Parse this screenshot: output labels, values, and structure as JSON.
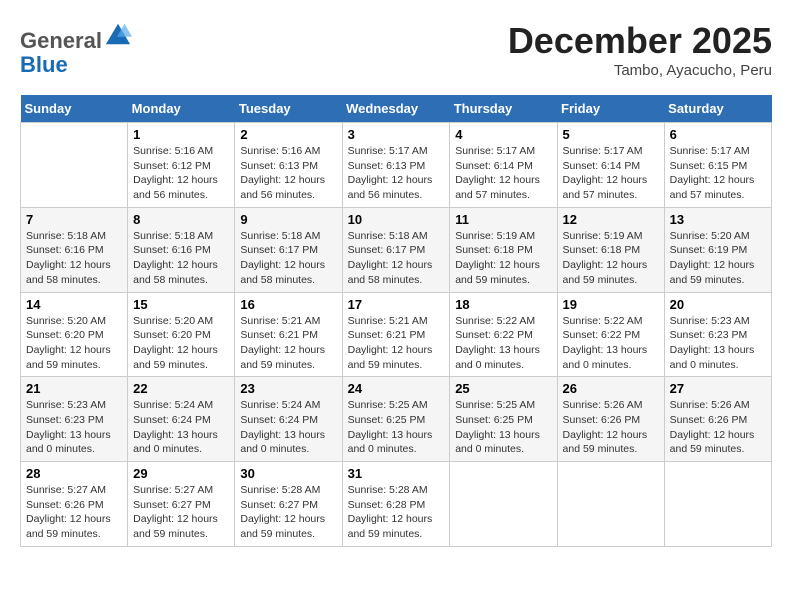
{
  "header": {
    "logo_line1": "General",
    "logo_line2": "Blue",
    "month": "December 2025",
    "location": "Tambo, Ayacucho, Peru"
  },
  "weekdays": [
    "Sunday",
    "Monday",
    "Tuesday",
    "Wednesday",
    "Thursday",
    "Friday",
    "Saturday"
  ],
  "weeks": [
    [
      {
        "day": "",
        "info": ""
      },
      {
        "day": "1",
        "info": "Sunrise: 5:16 AM\nSunset: 6:12 PM\nDaylight: 12 hours\nand 56 minutes."
      },
      {
        "day": "2",
        "info": "Sunrise: 5:16 AM\nSunset: 6:13 PM\nDaylight: 12 hours\nand 56 minutes."
      },
      {
        "day": "3",
        "info": "Sunrise: 5:17 AM\nSunset: 6:13 PM\nDaylight: 12 hours\nand 56 minutes."
      },
      {
        "day": "4",
        "info": "Sunrise: 5:17 AM\nSunset: 6:14 PM\nDaylight: 12 hours\nand 57 minutes."
      },
      {
        "day": "5",
        "info": "Sunrise: 5:17 AM\nSunset: 6:14 PM\nDaylight: 12 hours\nand 57 minutes."
      },
      {
        "day": "6",
        "info": "Sunrise: 5:17 AM\nSunset: 6:15 PM\nDaylight: 12 hours\nand 57 minutes."
      }
    ],
    [
      {
        "day": "7",
        "info": "Sunrise: 5:18 AM\nSunset: 6:16 PM\nDaylight: 12 hours\nand 58 minutes."
      },
      {
        "day": "8",
        "info": "Sunrise: 5:18 AM\nSunset: 6:16 PM\nDaylight: 12 hours\nand 58 minutes."
      },
      {
        "day": "9",
        "info": "Sunrise: 5:18 AM\nSunset: 6:17 PM\nDaylight: 12 hours\nand 58 minutes."
      },
      {
        "day": "10",
        "info": "Sunrise: 5:18 AM\nSunset: 6:17 PM\nDaylight: 12 hours\nand 58 minutes."
      },
      {
        "day": "11",
        "info": "Sunrise: 5:19 AM\nSunset: 6:18 PM\nDaylight: 12 hours\nand 59 minutes."
      },
      {
        "day": "12",
        "info": "Sunrise: 5:19 AM\nSunset: 6:18 PM\nDaylight: 12 hours\nand 59 minutes."
      },
      {
        "day": "13",
        "info": "Sunrise: 5:20 AM\nSunset: 6:19 PM\nDaylight: 12 hours\nand 59 minutes."
      }
    ],
    [
      {
        "day": "14",
        "info": "Sunrise: 5:20 AM\nSunset: 6:20 PM\nDaylight: 12 hours\nand 59 minutes."
      },
      {
        "day": "15",
        "info": "Sunrise: 5:20 AM\nSunset: 6:20 PM\nDaylight: 12 hours\nand 59 minutes."
      },
      {
        "day": "16",
        "info": "Sunrise: 5:21 AM\nSunset: 6:21 PM\nDaylight: 12 hours\nand 59 minutes."
      },
      {
        "day": "17",
        "info": "Sunrise: 5:21 AM\nSunset: 6:21 PM\nDaylight: 12 hours\nand 59 minutes."
      },
      {
        "day": "18",
        "info": "Sunrise: 5:22 AM\nSunset: 6:22 PM\nDaylight: 13 hours\nand 0 minutes."
      },
      {
        "day": "19",
        "info": "Sunrise: 5:22 AM\nSunset: 6:22 PM\nDaylight: 13 hours\nand 0 minutes."
      },
      {
        "day": "20",
        "info": "Sunrise: 5:23 AM\nSunset: 6:23 PM\nDaylight: 13 hours\nand 0 minutes."
      }
    ],
    [
      {
        "day": "21",
        "info": "Sunrise: 5:23 AM\nSunset: 6:23 PM\nDaylight: 13 hours\nand 0 minutes."
      },
      {
        "day": "22",
        "info": "Sunrise: 5:24 AM\nSunset: 6:24 PM\nDaylight: 13 hours\nand 0 minutes."
      },
      {
        "day": "23",
        "info": "Sunrise: 5:24 AM\nSunset: 6:24 PM\nDaylight: 13 hours\nand 0 minutes."
      },
      {
        "day": "24",
        "info": "Sunrise: 5:25 AM\nSunset: 6:25 PM\nDaylight: 13 hours\nand 0 minutes."
      },
      {
        "day": "25",
        "info": "Sunrise: 5:25 AM\nSunset: 6:25 PM\nDaylight: 13 hours\nand 0 minutes."
      },
      {
        "day": "26",
        "info": "Sunrise: 5:26 AM\nSunset: 6:26 PM\nDaylight: 12 hours\nand 59 minutes."
      },
      {
        "day": "27",
        "info": "Sunrise: 5:26 AM\nSunset: 6:26 PM\nDaylight: 12 hours\nand 59 minutes."
      }
    ],
    [
      {
        "day": "28",
        "info": "Sunrise: 5:27 AM\nSunset: 6:26 PM\nDaylight: 12 hours\nand 59 minutes."
      },
      {
        "day": "29",
        "info": "Sunrise: 5:27 AM\nSunset: 6:27 PM\nDaylight: 12 hours\nand 59 minutes."
      },
      {
        "day": "30",
        "info": "Sunrise: 5:28 AM\nSunset: 6:27 PM\nDaylight: 12 hours\nand 59 minutes."
      },
      {
        "day": "31",
        "info": "Sunrise: 5:28 AM\nSunset: 6:28 PM\nDaylight: 12 hours\nand 59 minutes."
      },
      {
        "day": "",
        "info": ""
      },
      {
        "day": "",
        "info": ""
      },
      {
        "day": "",
        "info": ""
      }
    ]
  ]
}
